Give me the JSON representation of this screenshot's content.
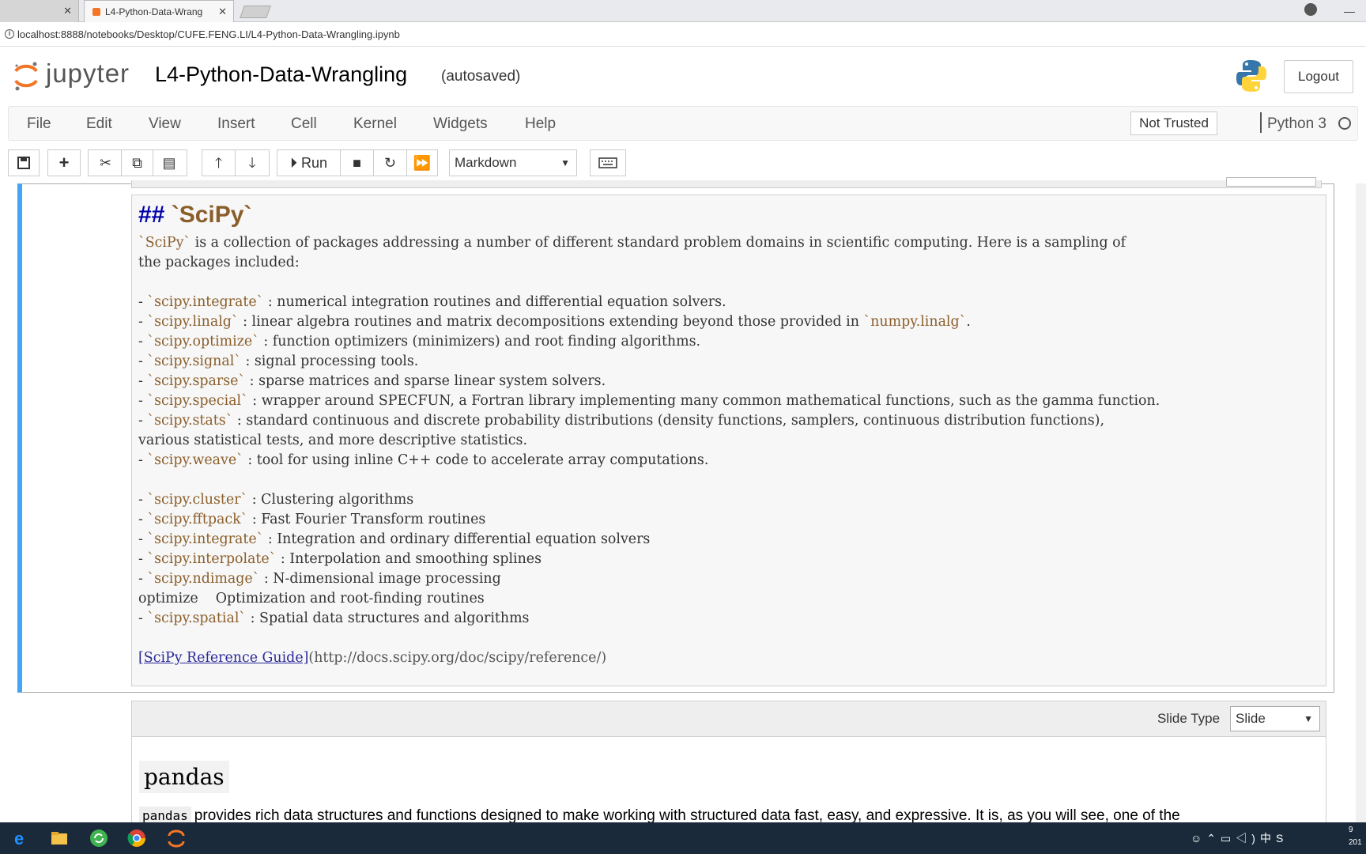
{
  "browser": {
    "tab1_title": "",
    "tab2_title": "L4-Python-Data-Wrang",
    "url": "localhost:8888/notebooks/Desktop/CUFE.FENG.LI/L4-Python-Data-Wrangling.ipynb"
  },
  "header": {
    "logo_text": "jupyter",
    "notebook_title": "L4-Python-Data-Wrangling",
    "autosave": "(autosaved)",
    "logout": "Logout"
  },
  "menu": {
    "items": [
      "File",
      "Edit",
      "View",
      "Insert",
      "Cell",
      "Kernel",
      "Widgets",
      "Help"
    ],
    "trust": "Not Trusted",
    "kernel": "Python 3"
  },
  "toolbar": {
    "run_label": "Run",
    "cell_type": "Markdown"
  },
  "cell1": {
    "heading_prefix": "## ",
    "heading_code": "`SciPy`",
    "lines": [
      [
        [
          "`SciPy`",
          "bq"
        ],
        [
          " is a collection of packages addressing a number of different standard problem domains in scientific computing. Here is a sampling of",
          ""
        ]
      ],
      [
        [
          "the packages included:",
          ""
        ]
      ],
      [
        [
          "",
          ""
        ]
      ],
      [
        [
          "- ",
          ""
        ],
        [
          "`scipy.integrate`",
          "bq"
        ],
        [
          " : numerical integration routines and differential equation solvers.",
          ""
        ]
      ],
      [
        [
          "- ",
          ""
        ],
        [
          "`scipy.linalg`",
          "bq"
        ],
        [
          " : linear algebra routines and matrix decompositions extending beyond those provided in ",
          ""
        ],
        [
          "`numpy.linalg`",
          "bq"
        ],
        [
          ".",
          ""
        ]
      ],
      [
        [
          "- ",
          ""
        ],
        [
          "`scipy.optimize`",
          "bq"
        ],
        [
          " : function optimizers (minimizers) and root finding algorithms.",
          ""
        ]
      ],
      [
        [
          "- ",
          ""
        ],
        [
          "`scipy.signal`",
          "bq"
        ],
        [
          " : signal processing tools.",
          ""
        ]
      ],
      [
        [
          "- ",
          ""
        ],
        [
          "`scipy.sparse`",
          "bq"
        ],
        [
          " : sparse matrices and sparse linear system solvers.",
          ""
        ]
      ],
      [
        [
          "- ",
          ""
        ],
        [
          "`scipy.special`",
          "bq"
        ],
        [
          " : wrapper around SPECFUN, a Fortran library implementing many common mathematical functions, such as the gamma function.",
          ""
        ]
      ],
      [
        [
          "- ",
          ""
        ],
        [
          "`scipy.stats`",
          "bq"
        ],
        [
          " : standard continuous and discrete probability distributions (density functions, samplers, continuous distribution functions),",
          ""
        ]
      ],
      [
        [
          "various statistical tests, and more descriptive statistics.",
          ""
        ]
      ],
      [
        [
          "- ",
          ""
        ],
        [
          "`scipy.weave`",
          "bq"
        ],
        [
          " : tool for using inline C++ code to accelerate array computations.",
          ""
        ]
      ],
      [
        [
          "",
          ""
        ]
      ],
      [
        [
          "- ",
          ""
        ],
        [
          "`scipy.cluster`",
          "bq"
        ],
        [
          " : Clustering algorithms",
          ""
        ]
      ],
      [
        [
          "- ",
          ""
        ],
        [
          "`scipy.fftpack`",
          "bq"
        ],
        [
          " : Fast Fourier Transform routines",
          ""
        ]
      ],
      [
        [
          "- ",
          ""
        ],
        [
          "`scipy.integrate`",
          "bq"
        ],
        [
          " : Integration and ordinary differential equation solvers",
          ""
        ]
      ],
      [
        [
          "- ",
          ""
        ],
        [
          "`scipy.interpolate`",
          "bq"
        ],
        [
          " : Interpolation and smoothing splines",
          ""
        ]
      ],
      [
        [
          "- ",
          ""
        ],
        [
          "`scipy.ndimage`",
          "bq"
        ],
        [
          " : N-dimensional image processing",
          ""
        ]
      ],
      [
        [
          "optimize    Optimization and root-finding routines",
          ""
        ]
      ],
      [
        [
          "- ",
          ""
        ],
        [
          "`scipy.spatial`",
          "bq"
        ],
        [
          " : Spatial data structures and algorithms",
          ""
        ]
      ],
      [
        [
          "",
          ""
        ]
      ],
      [
        [
          "[SciPy Reference Guide]",
          "lk"
        ],
        [
          "(http://docs.scipy.org/doc/scipy/reference/)",
          "url"
        ]
      ]
    ]
  },
  "cell2": {
    "slide_type_label": "Slide Type",
    "slide_type_value": "Slide",
    "heading": "pandas",
    "para_code": "pandas",
    "para_text": "provides rich data structures and functions designed to make working with structured data fast, easy, and expressive. It is, as you will see, one of the"
  },
  "taskbar": {
    "clock_top": "9",
    "clock_bottom": "201"
  },
  "colors": {
    "selected_border": "#42a5f5",
    "code_span": "#8a5e2a",
    "heading": "#0000aa",
    "jupyter_orange": "#f37626"
  }
}
